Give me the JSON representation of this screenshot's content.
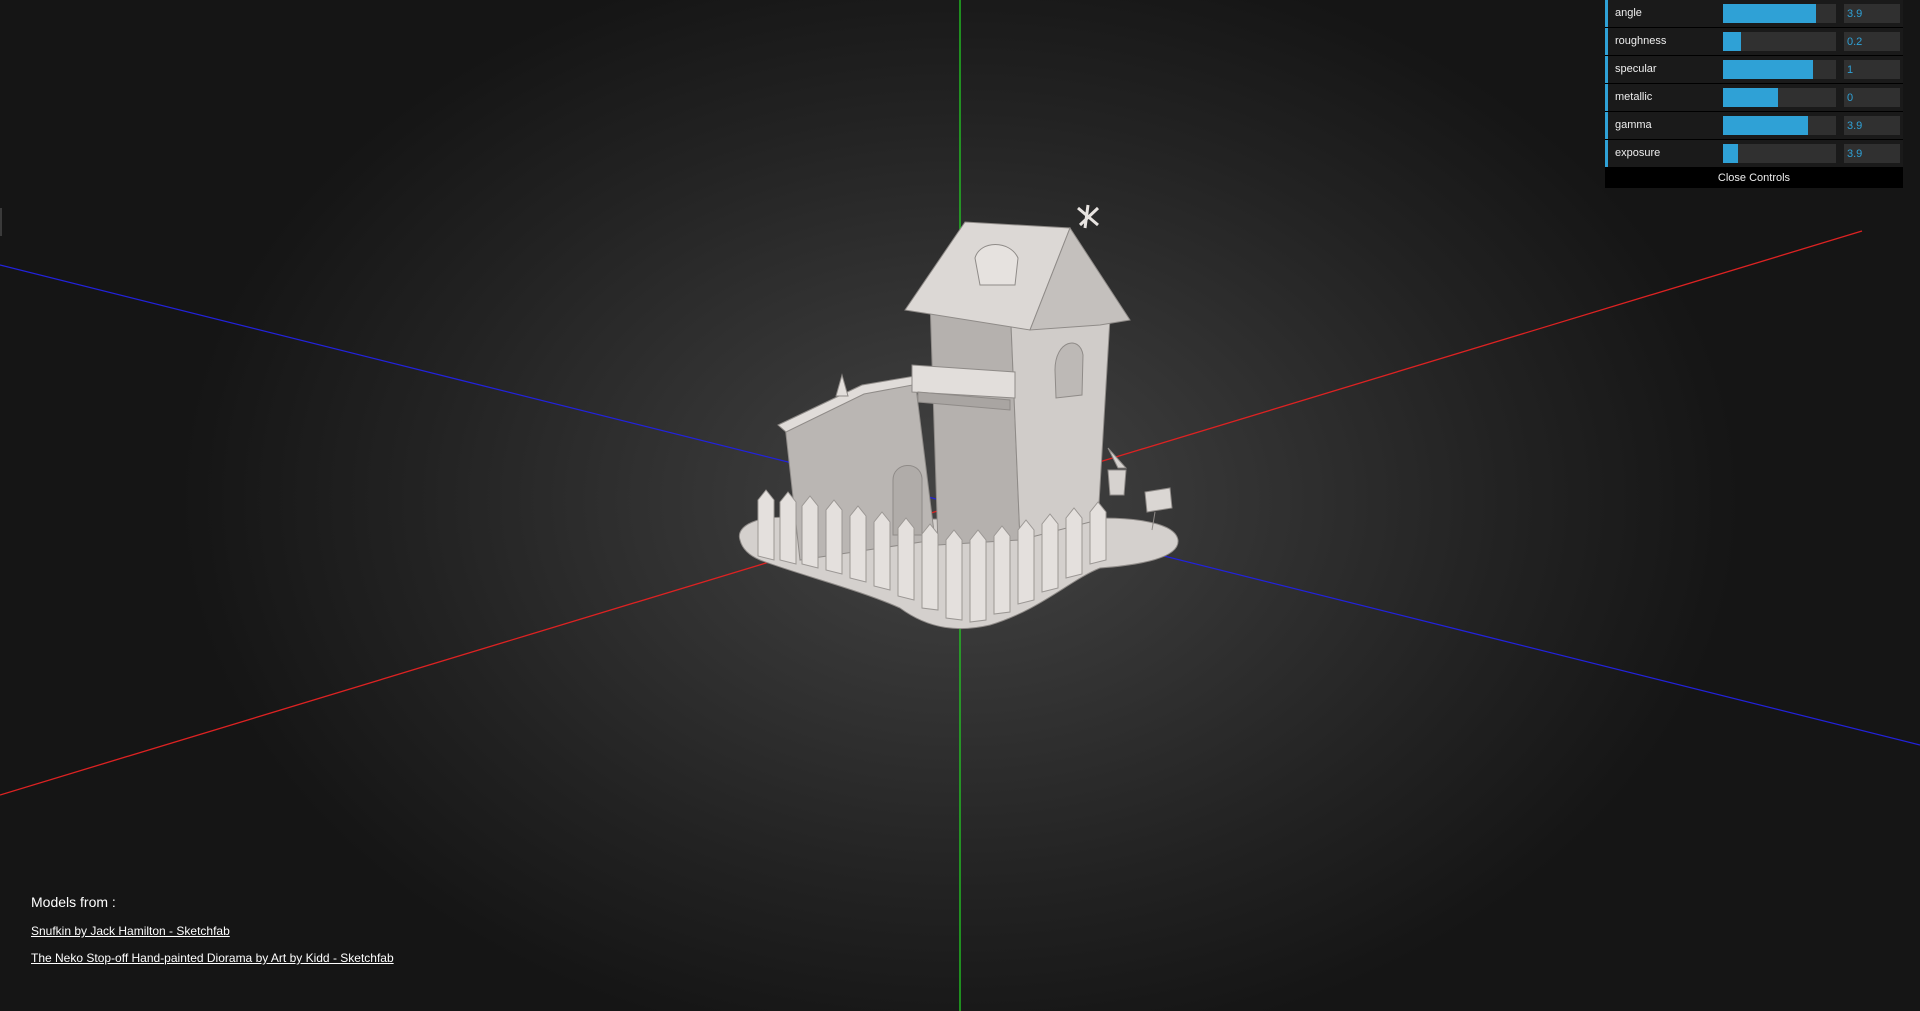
{
  "controls": {
    "rows": [
      {
        "label": "angle",
        "value": "3.9",
        "fill": 0.82
      },
      {
        "label": "roughness",
        "value": "0.2",
        "fill": 0.16
      },
      {
        "label": "specular",
        "value": "1",
        "fill": 0.8
      },
      {
        "label": "metallic",
        "value": "0",
        "fill": 0.49
      },
      {
        "label": "gamma",
        "value": "3.9",
        "fill": 0.75
      },
      {
        "label": "exposure",
        "value": "3.9",
        "fill": 0.13
      }
    ],
    "close_label": "Close Controls",
    "accent_color": "#2fa1d6"
  },
  "credits": {
    "title": "Models from :",
    "links": [
      "Snufkin by Jack Hamilton - Sketchfab",
      "The Neko Stop-off Hand-painted Diorama by Art by Kidd - Sketchfab"
    ]
  },
  "axes": {
    "x_color": "#ff2a2a",
    "y_color": "#22dd22",
    "z_color": "#2a2aff"
  }
}
